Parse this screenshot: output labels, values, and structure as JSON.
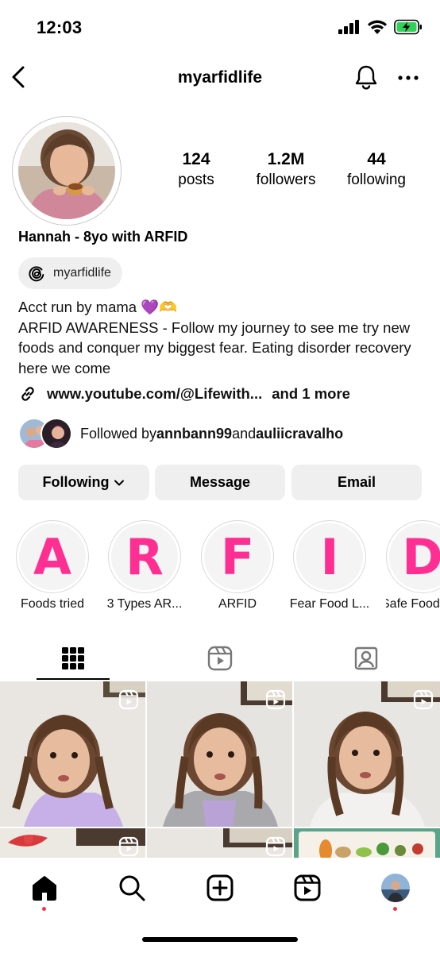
{
  "status_bar": {
    "time": "12:03"
  },
  "header": {
    "username": "myarfidlife"
  },
  "profile": {
    "stats": [
      {
        "value": "124",
        "label": "posts"
      },
      {
        "value": "1.2M",
        "label": "followers"
      },
      {
        "value": "44",
        "label": "following"
      }
    ],
    "full_name": "Hannah - 8yo with ARFID",
    "threads_handle": "myarfidlife",
    "bio_line1": "Acct run by mama 💜🫶",
    "bio_rest": "ARFID AWARENESS - Follow my journey to see me try new foods and conquer my biggest fear. Eating disorder recovery here we come",
    "link_text": "www.youtube.com/@Lifewith...",
    "link_more": "and 1 more",
    "followed_prefix": "Followed by ",
    "followed_user1": "annbann99",
    "followed_and": " and ",
    "followed_user2": "auliicravalho"
  },
  "buttons": {
    "following": "Following",
    "message": "Message",
    "email": "Email"
  },
  "highlights": [
    {
      "letter": "A",
      "caption": "Foods tried"
    },
    {
      "letter": "R",
      "caption": "3 Types AR..."
    },
    {
      "letter": "F",
      "caption": "ARFID"
    },
    {
      "letter": "I",
      "caption": "Fear Food L..."
    },
    {
      "letter": "D",
      "caption": "Safe Food"
    }
  ],
  "colors": {
    "highlight_letter": "#ff2e93",
    "notification_dot": "#ff3040"
  }
}
